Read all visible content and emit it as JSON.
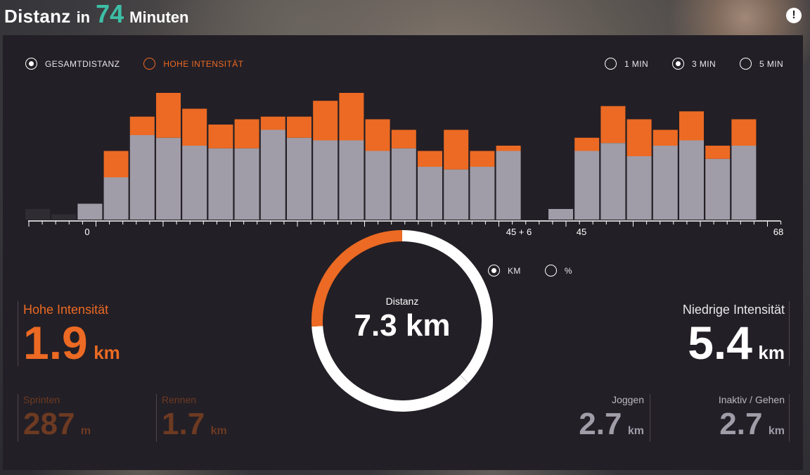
{
  "header": {
    "title": "Distanz",
    "in": "in",
    "minutes_value": "74",
    "minutes_label": "Minuten",
    "info_icon": "exclamation-icon"
  },
  "filters": {
    "series": [
      {
        "label": "GESAMTDISTANZ",
        "checked": true
      },
      {
        "label": "HOHE INTENSITÄT",
        "checked": false
      }
    ],
    "interval": [
      {
        "label": "1 MIN",
        "checked": false
      },
      {
        "label": "3 MIN",
        "checked": true
      },
      {
        "label": "5 MIN",
        "checked": false
      }
    ],
    "unit": [
      {
        "label": "KM",
        "checked": true
      },
      {
        "label": "%",
        "checked": false
      }
    ]
  },
  "colors": {
    "accent_teal": "#3dbfa6",
    "high_intensity": "#ec6a23",
    "low_intensity": "#a09ca8",
    "inactive_bar": "#2f2c34",
    "panel": "#231f26"
  },
  "chart_data": {
    "type": "bar",
    "stacked": true,
    "tick_labels": [
      "0",
      "45 + 6",
      "45",
      "68"
    ],
    "series": [
      {
        "values": [
          0.2,
          0.1,
          0.3,
          0.8,
          1.6,
          1.55,
          1.4,
          1.35,
          1.35,
          1.7,
          1.55,
          1.5,
          1.5,
          1.3,
          1.35,
          1.0,
          0.95,
          1.0,
          1.3,
          0.0,
          0.2,
          1.3,
          1.45,
          1.2,
          1.4,
          1.5,
          1.15,
          1.4
        ]
      },
      {
        "values": [
          0,
          0,
          0,
          0.5,
          0.35,
          0.85,
          0.7,
          0.45,
          0.55,
          0.25,
          0.4,
          0.75,
          0.9,
          0.6,
          0.35,
          0.3,
          0.75,
          0.3,
          0.1,
          0,
          0,
          0.25,
          0.7,
          0.7,
          0.3,
          0.55,
          0.25,
          0.5
        ]
      }
    ],
    "inactive_bars": [
      0,
      1,
      19
    ],
    "gaps_after": [
      19
    ]
  },
  "donut": {
    "label": "Distanz",
    "value": "7.3 km",
    "high_fraction": 0.26
  },
  "high": {
    "label": "Hohe Intensität",
    "value": "1.9",
    "unit": "km",
    "sprint_label": "Sprinten",
    "sprint_value": "287",
    "sprint_unit": "m",
    "run_label": "Rennen",
    "run_value": "1.7",
    "run_unit": "km"
  },
  "low": {
    "label": "Niedrige Intensität",
    "value": "5.4",
    "unit": "km",
    "jog_label": "Joggen",
    "jog_value": "2.7",
    "jog_unit": "km",
    "walk_label": "Inaktiv / Gehen",
    "walk_value": "2.7",
    "walk_unit": "km"
  }
}
